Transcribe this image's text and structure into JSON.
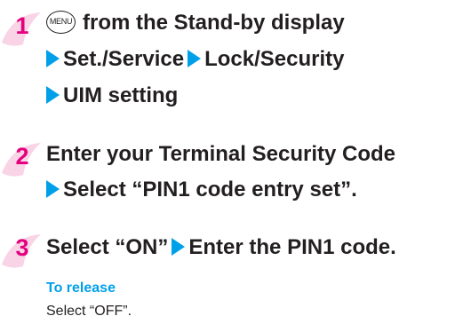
{
  "steps": [
    {
      "number": "1",
      "key_label": "MENU",
      "lines": [
        {
          "text": "from the Stand-by display"
        },
        {
          "parts": [
            "Set./Service",
            "Lock/Security"
          ]
        },
        {
          "parts": [
            "UIM setting"
          ]
        }
      ]
    },
    {
      "number": "2",
      "lines": [
        {
          "text": "Enter your Terminal Security Code"
        },
        {
          "parts": [
            "Select “PIN1 code entry set”."
          ]
        }
      ]
    },
    {
      "number": "3",
      "lines": [
        {
          "text": "Select “ON”",
          "after": "Enter the PIN1 code."
        }
      ]
    }
  ],
  "release": {
    "title": "To release",
    "text": "Select “OFF”."
  },
  "colors": {
    "step_number": "#e5007e",
    "arrow": "#00a0e9",
    "release_title": "#00a0e9",
    "text": "#231f20"
  }
}
